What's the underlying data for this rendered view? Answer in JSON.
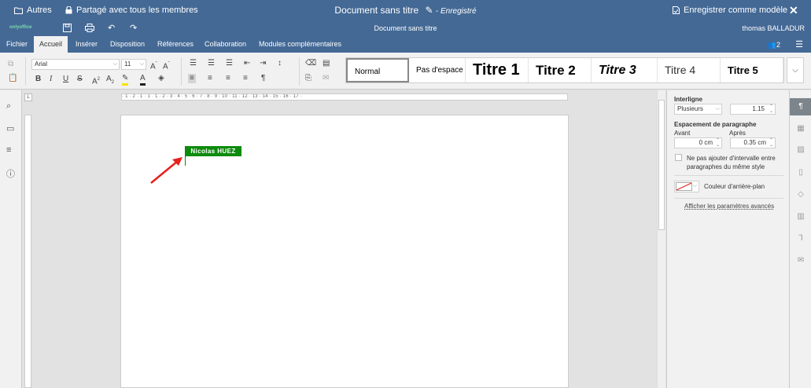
{
  "topbar": {
    "autres": "Autres",
    "share": "Partagé avec tous les membres",
    "doc_title": "Document sans titre",
    "saved": "- Enregistré",
    "save_as_template": "Enregistrer comme modèle"
  },
  "row2": {
    "doc_name": "Document sans titre",
    "user": "thomas BALLADUR",
    "logo": "onlyoffice"
  },
  "tabs": [
    "Fichier",
    "Accueil",
    "Insérer",
    "Disposition",
    "Références",
    "Collaboration",
    "Modules complémentaires"
  ],
  "users_count": "2",
  "ribbon": {
    "font_name": "Arial",
    "font_size": "11"
  },
  "styles": [
    "Normal",
    "Pas d'espace",
    "Titre 1",
    "Titre 2",
    "Titre 3",
    "Titre 4",
    "Titre 5"
  ],
  "collaborator": "Nicolas HUEZ",
  "ruler_text": "· 1 · 2 · 1 · 1 · 1 · 2 · 3 · 4 · 5 · 6 · 7 · 8 · 9 · 10 · 11 · 12 · 13 · 14 · 15 · 16 · 17 ·",
  "panel": {
    "line_spacing_label": "Interligne",
    "line_spacing_mode": "Plusieurs",
    "line_spacing_value": "1.15",
    "para_spacing_label": "Espacement de paragraphe",
    "before_label": "Avant",
    "after_label": "Après",
    "before_value": "0 cm",
    "after_value": "0.35 cm",
    "no_interval": "Ne pas ajouter d'intervalle entre paragraphes du même style",
    "bg_color": "Couleur d'arrière-plan",
    "advanced": "Afficher les paramètres avancés"
  },
  "colors": {
    "header": "#446995",
    "collab": "#0c8b0c",
    "arrow": "#e8201a"
  }
}
